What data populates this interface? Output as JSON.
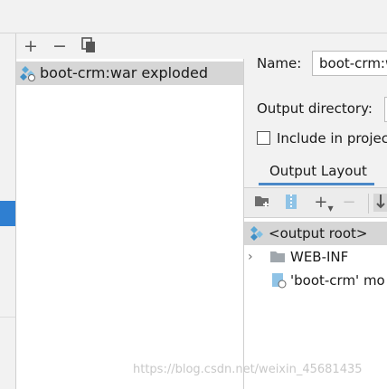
{
  "artifacts": {
    "toolbar": {
      "add": "+",
      "remove": "−",
      "copy": "copy"
    },
    "items": [
      {
        "label": "boot-crm:war exploded",
        "icon": "war-exploded-icon"
      }
    ]
  },
  "settings": {
    "name_label": "Name:",
    "name_value": "boot-crm:w",
    "output_dir_label": "Output directory:",
    "include_label": "Include in projec",
    "include_checked": false
  },
  "tabs": [
    {
      "label": "Output Layout",
      "active": true
    }
  ],
  "layout_toolbar": {
    "add_label": "+",
    "remove_label": "−"
  },
  "tree": [
    {
      "label": "<output root>",
      "icon": "output-root-icon"
    },
    {
      "label": "WEB-INF",
      "icon": "folder-icon"
    },
    {
      "label": "'boot-crm' mo",
      "icon": "module-icon"
    }
  ],
  "watermark": "https://blog.csdn.net/weixin_45681435",
  "colors": {
    "selection": "#d6d6d6",
    "accent": "#2f7fd1",
    "tab_underline": "#4a88c7"
  }
}
